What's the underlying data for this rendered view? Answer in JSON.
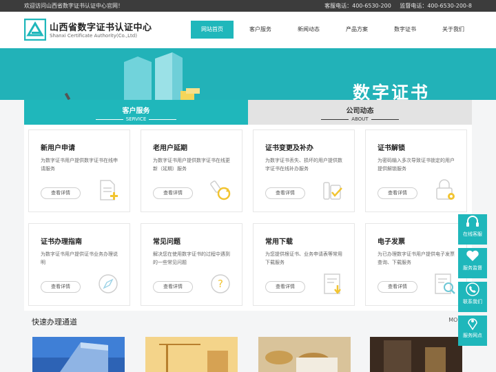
{
  "topbar": {
    "welcome": "欢迎访问山西省数字证书认证中心官网！",
    "service_phone": "客服电话：400-6530-200",
    "supervise_phone": "监督电话：400-6530-200-8"
  },
  "brand": {
    "name": "山西省数字证书认证中心",
    "english": "Shanxi Certificate Authority(Co.,Ltd)"
  },
  "nav": {
    "items": [
      "网站首页",
      "客户服务",
      "新闻动态",
      "产品方案",
      "数字证书",
      "关于我们"
    ],
    "active": "网站首页"
  },
  "banner": {
    "title": "数字证书"
  },
  "tabs": [
    {
      "label": "客户服务",
      "sub": "SERVICE"
    },
    {
      "label": "公司动态",
      "sub": "ABOUT"
    }
  ],
  "cards": [
    {
      "title": "新用户申请",
      "desc": "为数字证书用户提供数字证书在线申请服务",
      "button": "查看详情",
      "icon": "document-add-icon"
    },
    {
      "title": "老用户延期",
      "desc": "为数字证书用户提供数字证书在线更新（延期）服务",
      "button": "查看详情",
      "icon": "usb-key-refresh-icon"
    },
    {
      "title": "证书变更及补办",
      "desc": "为数字证书丢失、损坏的用户提供数字证书在线补办服务",
      "button": "查看详情",
      "icon": "usb-key-check-icon"
    },
    {
      "title": "证书解锁",
      "desc": "为密码输入多次导致证书锁定的用户提供解锁服务",
      "button": "查看详情",
      "icon": "unlock-gear-icon"
    },
    {
      "title": "证书办理指南",
      "desc": "为数字证书用户提供证书业务办理说明",
      "button": "查看详情",
      "icon": "compass-icon"
    },
    {
      "title": "常见问题",
      "desc": "解决您在使用数字证书的过程中遇到的一些常见问题",
      "button": "查看详情",
      "icon": "question-icon"
    },
    {
      "title": "常用下载",
      "desc": "为您提供根证书、业务申请表等常用下载服务",
      "button": "查看详情",
      "icon": "download-document-icon"
    },
    {
      "title": "电子发票",
      "desc": "为已办理数字证书用户提供电子发票查询、下载服务",
      "button": "查看详情",
      "icon": "invoice-search-icon"
    }
  ],
  "quick": {
    "title": "快速办理通道",
    "more": "MORE"
  },
  "sidebar": [
    {
      "label": "在线客服",
      "icon": "headset-icon"
    },
    {
      "label": "服务监督",
      "icon": "heart-hand-icon"
    },
    {
      "label": "联系我们",
      "icon": "phone-icon"
    },
    {
      "label": "服务网点",
      "icon": "location-pin-icon"
    }
  ],
  "colors": {
    "accent": "#1fb7bb",
    "topbar": "#3c3c3c"
  }
}
